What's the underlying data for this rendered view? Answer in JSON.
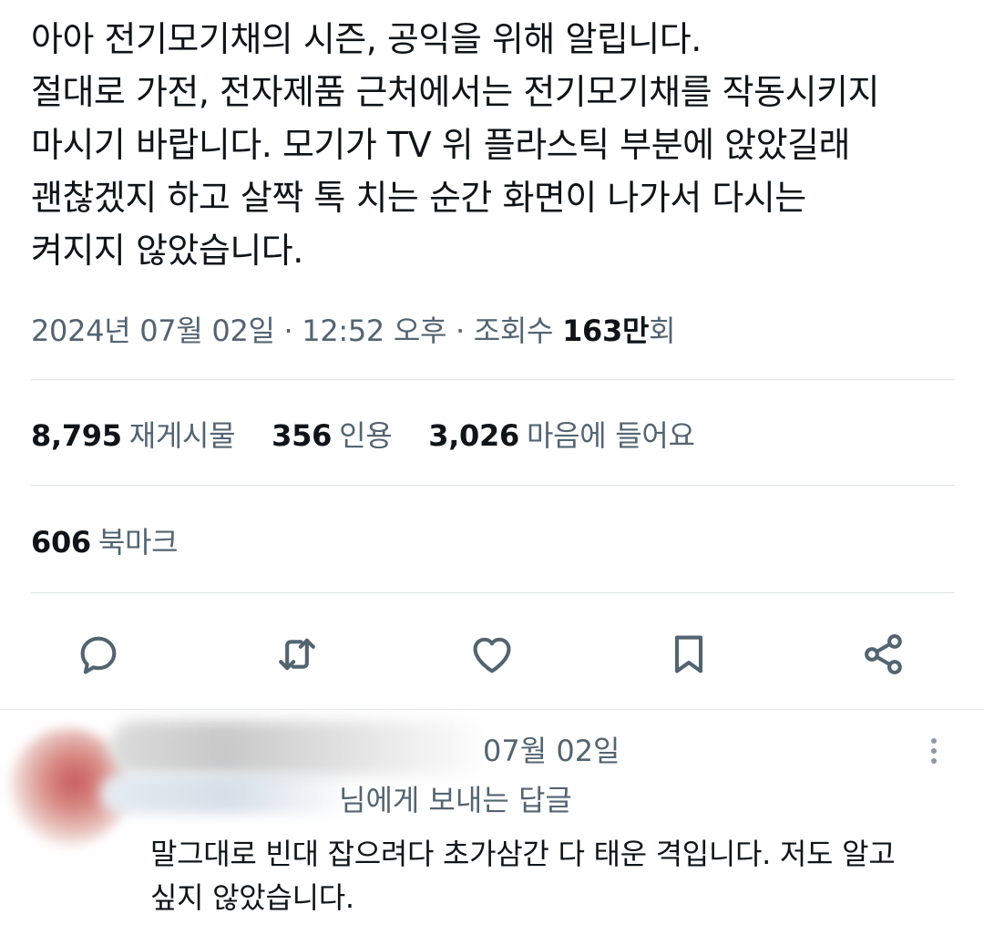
{
  "tweet": {
    "lines": [
      "아아 전기모기채의 시즌, 공익을 위해 알립니다.",
      "절대로 가전, 전자제품 근처에서는 전기모기채를 작동시키지",
      "마시기 바랍니다. 모기가 TV 위 플라스틱 부분에 앉았길래",
      "괜찮겠지 하고 살짝 톡 치는 순간 화면이 나가서 다시는",
      "켜지지 않았습니다."
    ],
    "meta": {
      "date": "2024년 07월 02일",
      "sep1": " · ",
      "time": "12:52 오후",
      "sep2": " · ",
      "views_label": "조회수 ",
      "views_value": "163만",
      "views_suffix": "회"
    }
  },
  "stats": {
    "reposts": {
      "value": "8,795",
      "label": "재게시물"
    },
    "quotes": {
      "value": "356",
      "label": "인용"
    },
    "likes": {
      "value": "3,026",
      "label": "마음에 들어요"
    },
    "bookmarks": {
      "value": "606",
      "label": "북마크"
    }
  },
  "actions": [
    {
      "icon": "reply-icon"
    },
    {
      "icon": "repost-icon"
    },
    {
      "icon": "like-icon"
    },
    {
      "icon": "bookmark-icon"
    },
    {
      "icon": "share-icon"
    }
  ],
  "reply": {
    "date": "07월 02일",
    "reply_to": "님에게 보내는 답글",
    "lines": [
      "말그대로 빈대 잡으려다 초가삼간 다 태운 격입니다. 저도 알고",
      "싶지 않았습니다."
    ]
  },
  "colors": {
    "text_primary": "#0f1419",
    "text_secondary": "#536471",
    "divider": "#dfe3e6"
  }
}
